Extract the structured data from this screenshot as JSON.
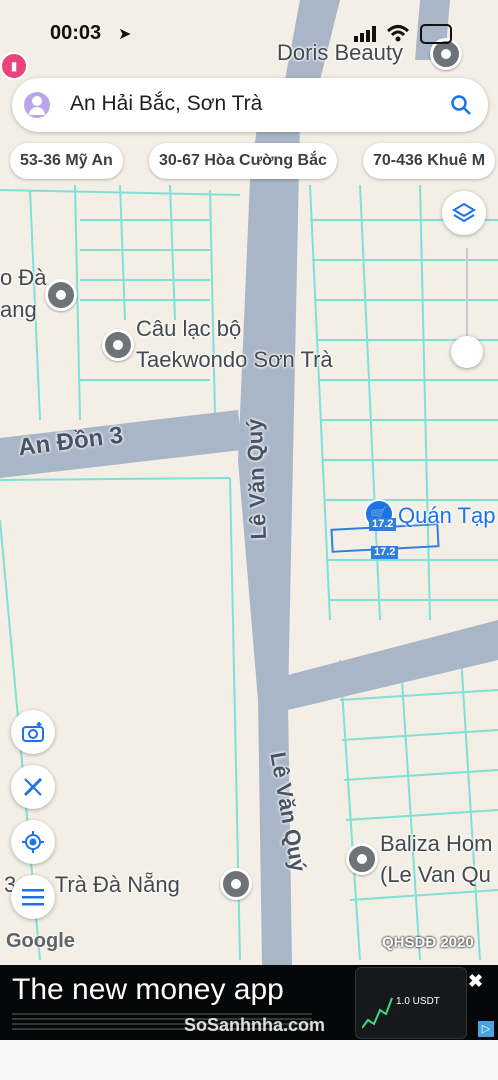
{
  "status_bar": {
    "time": "00:03"
  },
  "search": {
    "text": "An Hải Bắc, Sơn Trà"
  },
  "chips": [
    "53-36 Mỹ An",
    "30-67 Hòa Cường Bắc",
    "70-436 Khuê M"
  ],
  "places": {
    "doris": "Doris Beauty",
    "club_line1": "Câu lạc bộ",
    "club_line2": "Taekwondo Sơn Trà",
    "left_line1": "o Đà",
    "left_line2": "ang",
    "quan_tap": "Quán Tạp",
    "baliza_line1": "Baliza Hom",
    "baliza_line2": "(Le Van Qu",
    "bottom_place": "3 ơn Trà Đà Nẵng"
  },
  "roads": {
    "an_don_3": "An Đồn 3",
    "le_van_quy_upper": "Lê Văn Quý",
    "le_van_quy_lower": "Lê Văn Quý"
  },
  "lot_labels": [
    "17.2",
    "17.2"
  ],
  "map_attribution": {
    "logo": "Google",
    "layer": "QHSDĐ 2020"
  },
  "ad": {
    "headline": "The new money app",
    "watermark": "SoSanhnha.com",
    "price_tag": "1.0 USDT"
  },
  "icons": [
    "location-arrow-icon",
    "signal-icon",
    "wifi-icon",
    "avatar-icon",
    "search-icon",
    "layers-icon",
    "camera-icon",
    "measure-icon",
    "locate-icon",
    "menu-icon",
    "close-icon",
    "hotel-icon",
    "shop-icon"
  ]
}
